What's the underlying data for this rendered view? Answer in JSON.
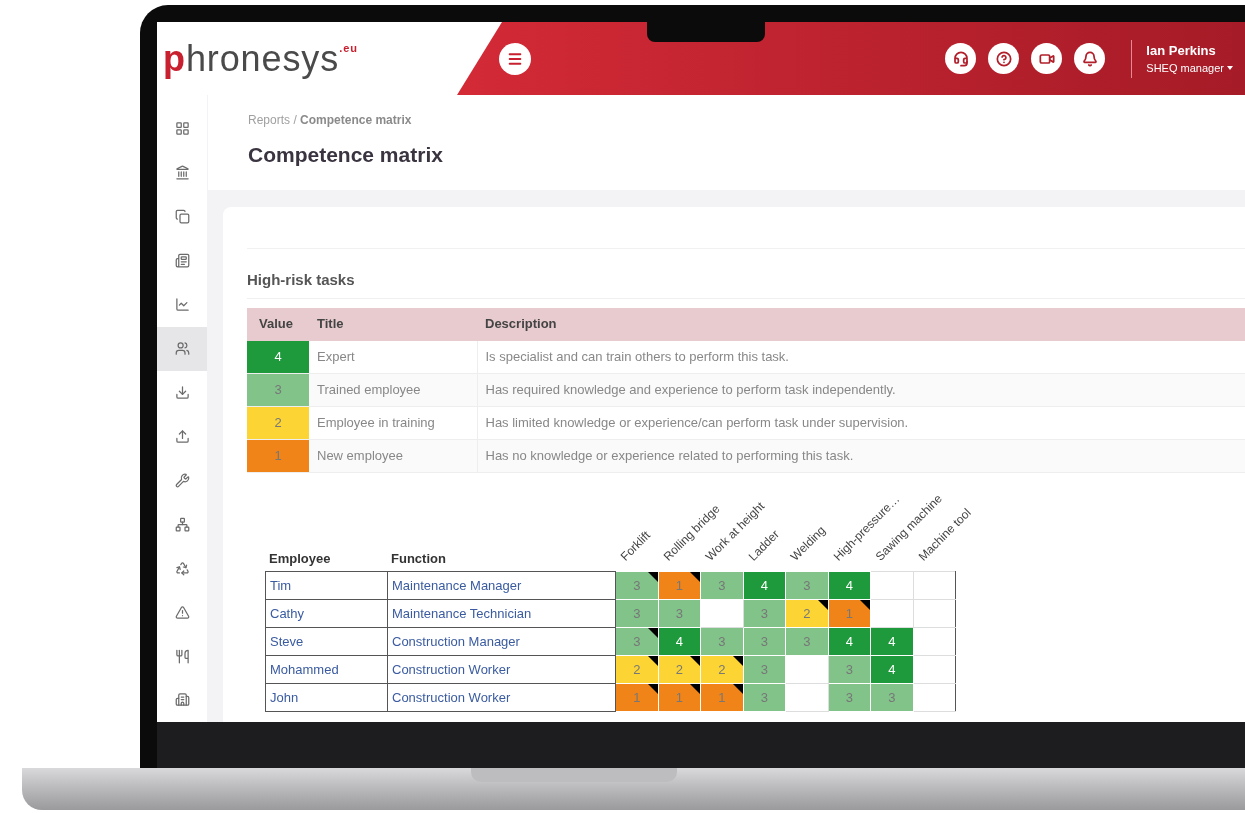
{
  "logo": {
    "mark": "p",
    "name": "hronesys",
    "suffix": ".eu"
  },
  "header": {
    "user": {
      "name": "Ian Perkins",
      "role": "SHEQ manager"
    }
  },
  "sidebar": {
    "items": [
      {
        "selected": false
      },
      {
        "selected": false
      },
      {
        "selected": false
      },
      {
        "selected": false
      },
      {
        "selected": false
      },
      {
        "selected": true
      },
      {
        "selected": false
      },
      {
        "selected": false
      },
      {
        "selected": false
      },
      {
        "selected": false
      },
      {
        "selected": false
      },
      {
        "selected": false
      },
      {
        "selected": false
      },
      {
        "selected": false
      }
    ]
  },
  "breadcrumb": {
    "parent": "Reports",
    "separator": "/",
    "current": "Competence matrix"
  },
  "title": "Competence matrix",
  "section": "High-risk tasks",
  "legend": {
    "columns": [
      "Value",
      "Title",
      "Description"
    ],
    "rows": [
      {
        "value": "4",
        "color": "#1e9a3c",
        "title": "Expert",
        "description": "Is specialist and can train others to perform this task."
      },
      {
        "value": "3",
        "color": "#82c38a",
        "title": "Trained employee",
        "description": "Has required knowledge and experience to perform task independently."
      },
      {
        "value": "2",
        "color": "#fcd535",
        "title": "Employee in training",
        "description": "Has limited knowledge or experience/can perform task under supervision."
      },
      {
        "value": "1",
        "color": "#f08419",
        "title": "New employee",
        "description": "Has no knowledge or experience related to performing this task."
      }
    ]
  },
  "matrix": {
    "employee_heading": "Employee",
    "function_heading": "Function",
    "tasks": [
      "Forklift",
      "Rolling bridge",
      "Work at height",
      "Ladder",
      "Welding",
      "High-pressure…",
      "Sawing machine",
      "Machine tool"
    ],
    "rows": [
      {
        "employee": "Tim",
        "function": "Maintenance Manager",
        "cells": [
          {
            "value": "3",
            "color": "#82c38a",
            "flag": true
          },
          {
            "value": "1",
            "color": "#f08419",
            "flag": true
          },
          {
            "value": "3",
            "color": "#82c38a",
            "flag": false
          },
          {
            "value": "4",
            "color": "#1e9a3c",
            "flag": false
          },
          {
            "value": "3",
            "color": "#82c38a",
            "flag": false
          },
          {
            "value": "4",
            "color": "#1e9a3c",
            "flag": false
          },
          {
            "flag": false
          },
          {
            "flag": false
          }
        ]
      },
      {
        "employee": "Cathy",
        "function": "Maintenance Technician",
        "cells": [
          {
            "value": "3",
            "color": "#82c38a",
            "flag": false
          },
          {
            "value": "3",
            "color": "#82c38a",
            "flag": false
          },
          {
            "flag": false
          },
          {
            "value": "3",
            "color": "#82c38a",
            "flag": false
          },
          {
            "value": "2",
            "color": "#fcd535",
            "flag": true
          },
          {
            "value": "1",
            "color": "#f08419",
            "flag": true
          },
          {
            "flag": false
          },
          {
            "flag": false
          }
        ]
      },
      {
        "employee": "Steve",
        "function": "Construction Manager",
        "cells": [
          {
            "value": "3",
            "color": "#82c38a",
            "flag": true
          },
          {
            "value": "4",
            "color": "#1e9a3c",
            "flag": false
          },
          {
            "value": "3",
            "color": "#82c38a",
            "flag": false
          },
          {
            "value": "3",
            "color": "#82c38a",
            "flag": false
          },
          {
            "value": "3",
            "color": "#82c38a",
            "flag": false
          },
          {
            "value": "4",
            "color": "#1e9a3c",
            "flag": false
          },
          {
            "value": "4",
            "color": "#1e9a3c",
            "flag": false
          },
          {
            "flag": false
          }
        ]
      },
      {
        "employee": "Mohammed",
        "function": "Construction Worker",
        "cells": [
          {
            "value": "2",
            "color": "#fcd535",
            "flag": true
          },
          {
            "value": "2",
            "color": "#fcd535",
            "flag": true
          },
          {
            "value": "2",
            "color": "#fcd535",
            "flag": true
          },
          {
            "value": "3",
            "color": "#82c38a",
            "flag": false
          },
          {
            "flag": false
          },
          {
            "value": "3",
            "color": "#82c38a",
            "flag": false
          },
          {
            "value": "4",
            "color": "#1e9a3c",
            "flag": false
          },
          {
            "flag": false
          }
        ]
      },
      {
        "employee": "John",
        "function": "Construction Worker",
        "cells": [
          {
            "value": "1",
            "color": "#f08419",
            "flag": true
          },
          {
            "value": "1",
            "color": "#f08419",
            "flag": true
          },
          {
            "value": "1",
            "color": "#f08419",
            "flag": true
          },
          {
            "value": "3",
            "color": "#82c38a",
            "flag": false
          },
          {
            "flag": false
          },
          {
            "value": "3",
            "color": "#82c38a",
            "flag": false
          },
          {
            "value": "3",
            "color": "#82c38a",
            "flag": false
          },
          {
            "flag": false
          }
        ]
      }
    ]
  }
}
